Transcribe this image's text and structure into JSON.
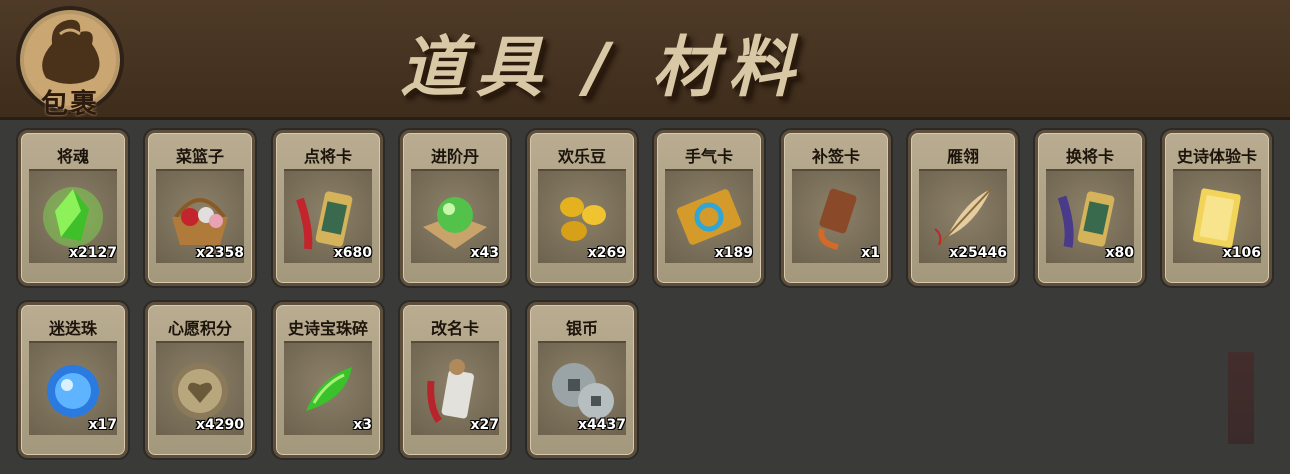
{
  "header": {
    "bag_label": "包裹",
    "title": "道具 / 材料"
  },
  "items": [
    {
      "name": "将魂",
      "count": "x2127",
      "icon": "green-crystal-icon"
    },
    {
      "name": "菜篮子",
      "count": "x2358",
      "icon": "flower-basket-icon"
    },
    {
      "name": "点将卡",
      "count": "x680",
      "icon": "general-token-icon"
    },
    {
      "name": "进阶丹",
      "count": "x43",
      "icon": "green-orb-icon"
    },
    {
      "name": "欢乐豆",
      "count": "x269",
      "icon": "gold-beans-icon"
    },
    {
      "name": "手气卡",
      "count": "x189",
      "icon": "refresh-card-icon"
    },
    {
      "name": "补签卡",
      "count": "x1",
      "icon": "signature-tag-icon"
    },
    {
      "name": "雁翎",
      "count": "x25446",
      "icon": "feather-icon"
    },
    {
      "name": "换将卡",
      "count": "x80",
      "icon": "swap-token-icon"
    },
    {
      "name": "史诗体验卡",
      "count": "x106",
      "icon": "gold-card-icon"
    },
    {
      "name": "迷迭珠",
      "count": "x17",
      "icon": "blue-orb-icon"
    },
    {
      "name": "心愿积分",
      "count": "x4290",
      "icon": "heart-coin-icon"
    },
    {
      "name": "史诗宝珠碎",
      "count": "x3",
      "icon": "green-shard-icon"
    },
    {
      "name": "改名卡",
      "count": "x27",
      "icon": "rename-token-icon"
    },
    {
      "name": "银币",
      "count": "x4437",
      "icon": "silver-coins-icon"
    }
  ]
}
